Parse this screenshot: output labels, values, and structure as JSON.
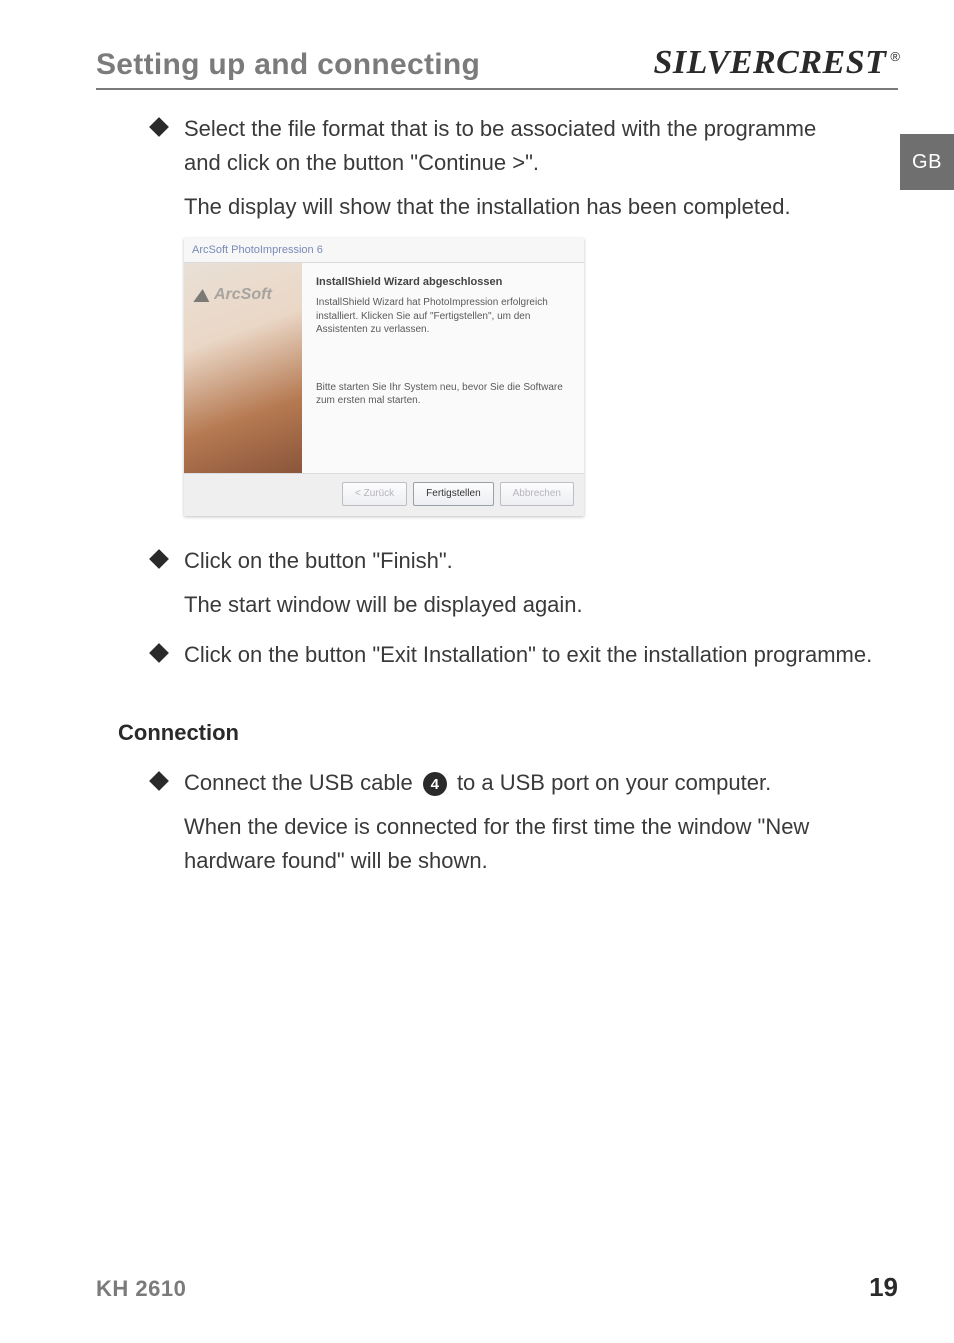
{
  "header": {
    "title": "Setting up and connecting"
  },
  "brand": {
    "name": "SILVERCREST",
    "mark": "®"
  },
  "tab": {
    "label": "GB"
  },
  "bullets": {
    "b1_line1": "Select the file format that is to be associated with the programme",
    "b1_line2": "and click on the button \"Continue >\".",
    "b1_after": "The display will show that the installation has been completed.",
    "b2": "Click on the button \"Finish\".",
    "b2_after": "The start window will be displayed again.",
    "b3": "Click on the button \"Exit Installation\" to exit the installation programme."
  },
  "connection": {
    "title": "Connection",
    "c1_pre": "Connect the USB cable ",
    "c1_num": "4",
    "c1_post": " to a USB port on your computer.",
    "c1_after_l1": "When the device is connected for the first time the window \"New",
    "c1_after_l2": "hardware found\" will be shown."
  },
  "screenshot": {
    "window_title": "ArcSoft PhotoImpression 6",
    "logo": "ArcSoft",
    "heading": "InstallShield Wizard abgeschlossen",
    "para1": "InstallShield Wizard hat PhotoImpression erfolgreich installiert. Klicken Sie auf \"Fertigstellen\", um den Assistenten zu verlassen.",
    "para2": "Bitte starten Sie Ihr System neu, bevor Sie die Software zum ersten mal starten.",
    "buttons": {
      "back": "< Zurück",
      "finish": "Fertigstellen",
      "cancel": "Abbrechen"
    }
  },
  "footer": {
    "model": "KH 2610",
    "page": "19"
  }
}
